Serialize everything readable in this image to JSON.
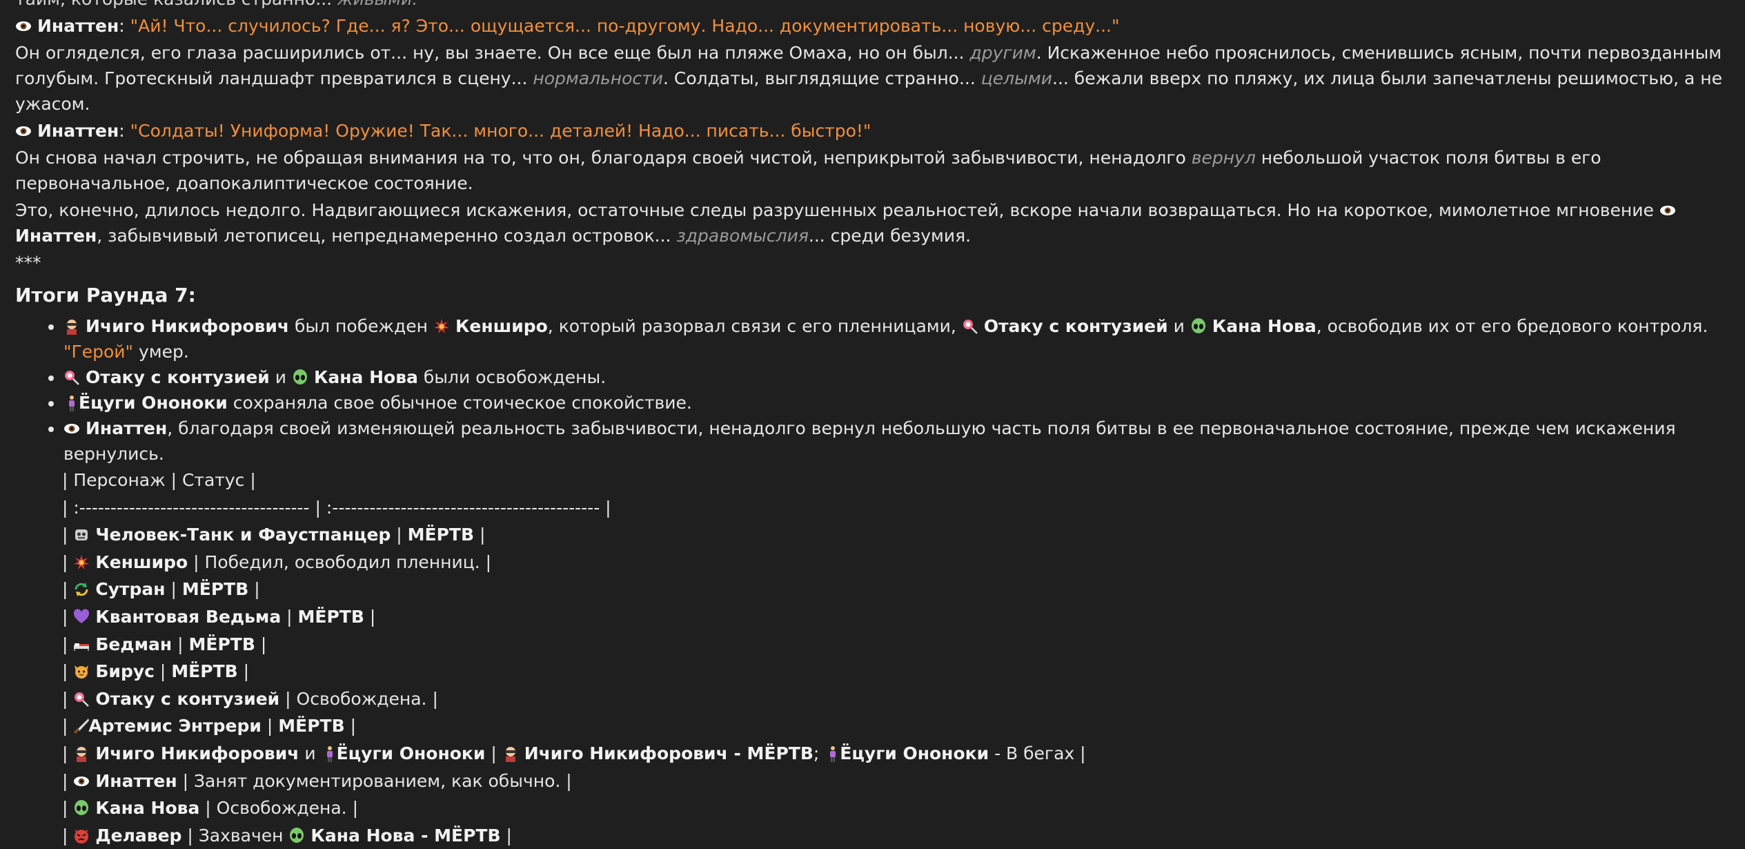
{
  "top_cut_line": {
    "text": "тайм, которые казались странно...",
    "em": "живыми."
  },
  "para1": {
    "speaker": "Инаттен",
    "quote": "\"Ай! Что... случилось? Где... я? Это... ощущается... по-другому. Надо... документировать... новую... среду...\""
  },
  "para2": {
    "a": "Он огляделся, его глаза расширились от... ну, вы знаете. Он все еще был на пляже Омаха, но он был... ",
    "em1": "другим",
    "b": ". Искаженное небо прояснилось, сменившись ясным, почти первозданным голубым. Гротескный ландшафт превратился в сцену... ",
    "em2": "нормальности",
    "c": ". Солдаты, выглядящие странно... ",
    "em3": "целыми",
    "d": "... бежали вверх по пляжу, их лица были запечатлены решимостью, а не ужасом."
  },
  "para3": {
    "speaker": "Инаттен",
    "quote": "\"Солдаты! Униформа! Оружие! Так... много... деталей! Надо... писать... быстро!\""
  },
  "para4": {
    "a": "Он снова начал строчить, не обращая внимания на то, что он, благодаря своей чистой, неприкрытой забывчивости, ненадолго ",
    "em": "вернул",
    "b": " небольшой участок поля битвы в его первоначальное, доапокалиптическое состояние."
  },
  "para5": {
    "a": "Это, конечно, длилось недолго. Надвигающиеся искажения, остаточные следы разрушенных реальностей, вскоре начали возвращаться. Но на короткое, мимолетное мгновение ",
    "speaker": "Инаттен",
    "b": ", забывчивый летописец, непреднамеренно создал островок... ",
    "em": "здравомыслия",
    "c": "... среди безумия."
  },
  "separator": "***",
  "summary_title": "Итоги Раунда 7:",
  "bullets": [
    {
      "n1": "Ичиго Никифорович",
      "t1": " был побежден ",
      "n2": "Кенширо",
      "t2": ", который разорвал связи с его пленницами, ",
      "n3": "Отаку с контузией",
      "t3": " и ",
      "n4": "Кана Нова",
      "t4": ", освободив их от его бредового контроля. ",
      "q": "\"Герой\"",
      "t5": " умер."
    },
    {
      "n1": "Отаку с контузией",
      "t1": " и ",
      "n2": "Кана Нова",
      "t2": " были освобождены."
    },
    {
      "n1": "Ёцуги Ононоки",
      "t1": " сохраняла свое обычное стоическое спокойствие."
    },
    {
      "n1": "Инаттен",
      "t1": ", благодаря своей изменяющей реальность забывчивости, ненадолго вернул небольшую часть поля битвы в ее первоначальное состояние, прежде чем искажения вернулись."
    }
  ],
  "table": {
    "header": "| Персонаж | Статус |",
    "divider": "| :------------------------------------- | :------------------------------------------- |",
    "rows": [
      {
        "icon": "robot-icon",
        "name": "Человек-Танк и Фаустпанцер",
        "status_bold": "МЁРТВ",
        "status": ""
      },
      {
        "icon": "explosion-icon",
        "name": "Кенширо",
        "status_bold": "",
        "status": "Победил, освободил пленниц."
      },
      {
        "icon": "cycle-arrows-icon",
        "name": "Сутран",
        "status_bold": "МЁРТВ",
        "status": ""
      },
      {
        "icon": "purple-heart-icon",
        "name": "Квантовая Ведьма",
        "status_bold": "МЁРТВ",
        "status": ""
      },
      {
        "icon": "bed-icon",
        "name": "Бедман",
        "status_bold": "МЁРТВ",
        "status": ""
      },
      {
        "icon": "cat-face-icon",
        "name": "Бирус",
        "status_bold": "МЁРТВ",
        "status": ""
      },
      {
        "icon": "lollipop-icon",
        "name": "Отаку с контузией",
        "status_bold": "",
        "status": "Освобождена."
      },
      {
        "icon": "knife-icon",
        "name": "Артемис Энтрери",
        "status_bold": "МЁРТВ",
        "status": ""
      },
      {
        "icon": "ninja-icon",
        "name": "Ичиго Никифорович",
        "joiner": " и ",
        "icon2": "standing-person-icon",
        "name2": "Ёцуги Ононоки",
        "s_icon1": "ninja-icon",
        "s_name1": "Ичиго Никифорович - МЁРТВ",
        "s_sep": "; ",
        "s_icon2": "standing-person-icon",
        "s_name2": "Ёцуги Ононоки",
        "s_tail": " - В бегах"
      },
      {
        "icon": "eye-icon",
        "name": "Инаттен",
        "status_bold": "",
        "status": "Занят документированием, как обычно."
      },
      {
        "icon": "alien-icon",
        "name": "Кана Нова",
        "status_bold": "",
        "status": "Освобождена."
      },
      {
        "icon": "angry-devil-icon",
        "name": "Делавер",
        "status_bold": "",
        "status": "Захвачен ",
        "s_icon": "alien-icon",
        "s_bold": "Кана Нова - МЁРТВ"
      }
    ]
  },
  "colors": {
    "background": "#1f1f1f",
    "text": "#e6e6e6",
    "quote": "#f0903e",
    "emphasis": "#9b9b9b"
  }
}
